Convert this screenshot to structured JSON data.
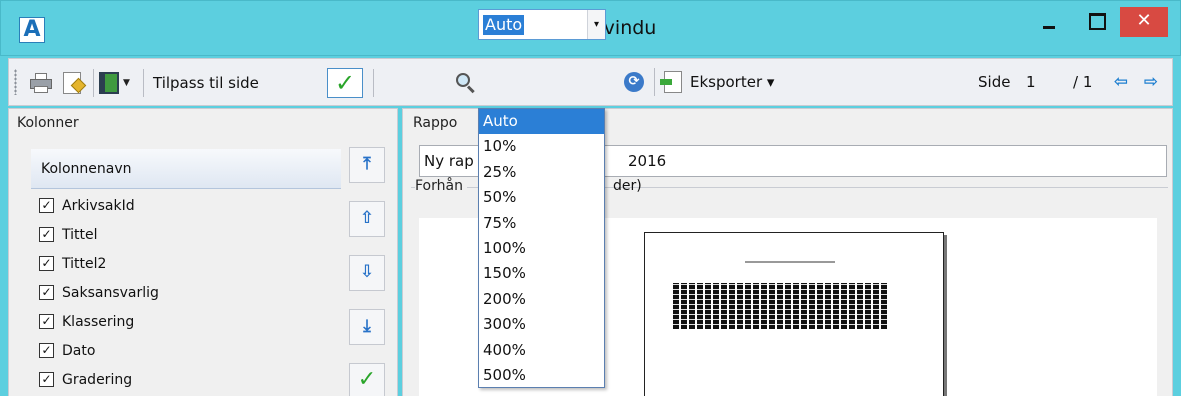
{
  "window": {
    "title": "Utskriftsvindu",
    "app_icon_letter": "A",
    "close_glyph": "✕"
  },
  "toolbar": {
    "fit_to_page_label": "Tilpass til side",
    "fit_check": "✓",
    "zoom_value": "Auto",
    "zoom_arrow": "▾",
    "export_label": "Eksporter ▾",
    "page_label": "Side",
    "current_page": "1",
    "page_total": "/ 1",
    "prev_glyph": "⇦",
    "next_glyph": "⇨",
    "refresh_glyph": "⟳"
  },
  "columns_panel": {
    "title": "Kolonner",
    "list_header": "Kolonnenavn",
    "items": [
      {
        "label": "ArkivsakId",
        "checked": "✓"
      },
      {
        "label": "Tittel",
        "checked": "✓"
      },
      {
        "label": "Tittel2",
        "checked": "✓"
      },
      {
        "label": "Saksansvarlig",
        "checked": "✓"
      },
      {
        "label": "Klassering",
        "checked": "✓"
      },
      {
        "label": "Dato",
        "checked": "✓"
      },
      {
        "label": "Gradering",
        "checked": "✓"
      }
    ],
    "buttons": {
      "top": "⤒",
      "up": "⇧",
      "down": "⇩",
      "bottom": "⤓",
      "ok": "✓"
    }
  },
  "report_panel": {
    "title_visible": "Rappo",
    "name_prefix": "Ny rap",
    "name_suffix": "2016",
    "preview_prefix": "Forhån",
    "preview_suffix": "der)"
  },
  "zoom_dropdown": {
    "selected": "Auto",
    "options": [
      "Auto",
      "10%",
      "25%",
      "50%",
      "75%",
      "100%",
      "150%",
      "200%",
      "300%",
      "400%",
      "500%"
    ]
  },
  "colors": {
    "title_bar": "#5ccfdf",
    "selection": "#2b7fd6",
    "close_button": "#d84a42"
  }
}
